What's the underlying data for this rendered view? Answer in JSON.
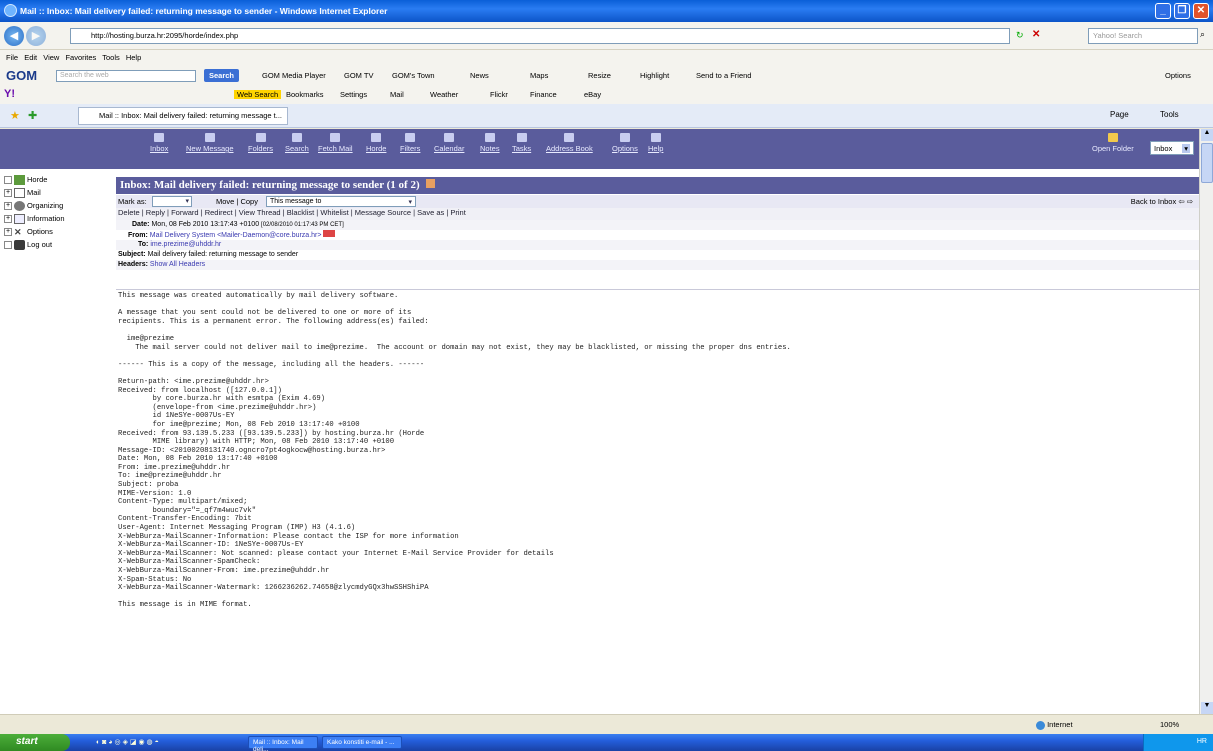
{
  "window": {
    "title": "Mail :: Inbox: Mail delivery failed: returning message to sender - Windows Internet Explorer",
    "url": "http://hosting.burza.hr:2095/horde/index.php",
    "search_placeholder": "Yahoo! Search"
  },
  "menubar": [
    "File",
    "Edit",
    "View",
    "Favorites",
    "Tools",
    "Help"
  ],
  "toolbar1": {
    "gom_search_placeholder": "Search the web",
    "search_button": "Search",
    "items": [
      "GOM Media Player",
      "GOM TV",
      "GOM's Town",
      "News",
      "Maps",
      "Resize",
      "Highlight",
      "Send to a Friend"
    ],
    "options": "Options"
  },
  "toolbar2": {
    "items": [
      "Web Search",
      "Bookmarks",
      "Settings",
      "Mail",
      "Weather",
      "Flickr",
      "Finance",
      "eBay"
    ]
  },
  "tab": {
    "label": "Mail :: Inbox: Mail delivery failed: returning message t..."
  },
  "command_bar": [
    "Page",
    "Tools"
  ],
  "horde_menu": {
    "items": [
      "Inbox",
      "New Message",
      "Folders",
      "Search",
      "Fetch Mail",
      "Horde",
      "Filters",
      "Calendar",
      "Notes",
      "Tasks",
      "Address Book",
      "Options",
      "Help"
    ],
    "open_folder": "Open Folder",
    "folder_select": "Inbox"
  },
  "sidebar": {
    "items": [
      "Horde",
      "Mail",
      "Organizing",
      "Information",
      "Options",
      "Log out"
    ]
  },
  "message": {
    "subject_title": "Inbox: Mail delivery failed: returning message to sender (1 of 2)",
    "mark_as": "Mark as:",
    "move_copy": "Move | Copy",
    "target_select": "This message to",
    "back_link": "Back to Inbox",
    "actions": "Delete | Reply | Forward | Redirect | View Thread | Blacklist | Whitelist | Message Source | Save as | Print",
    "date_label": "Date:",
    "date_value": "Mon, 08 Feb 2010 13:17:43 +0100",
    "date_local": "[02/08/2010 01:17:43 PM CET]",
    "from_label": "From:",
    "from_value": "Mail Delivery System <Mailer-Daemon@core.burza.hr>",
    "to_label": "To:",
    "to_value": "ime.prezime@uhddr.hr",
    "subject_label": "Subject:",
    "subject_value": "Mail delivery failed: returning message to sender",
    "headers_label": "Headers:",
    "headers_link": "Show All Headers"
  },
  "body_lines": [
    "This message was created automatically by mail delivery software.",
    "",
    "A message that you sent could not be delivered to one or more of its",
    "recipients. This is a permanent error. The following address(es) failed:",
    "",
    "  ime@prezime",
    "    The mail server could not deliver mail to ime@prezime.  The account or domain may not exist, they may be blacklisted, or missing the proper dns entries.",
    "",
    "------ This is a copy of the message, including all the headers. ------",
    "",
    "Return-path: <ime.prezime@uhddr.hr>",
    "Received: from localhost ([127.0.0.1])",
    "        by core.burza.hr with esmtpa (Exim 4.69)",
    "        (envelope-from <ime.prezime@uhddr.hr>)",
    "        id 1NeSYe-0007Us-EY",
    "        for ime@prezime; Mon, 08 Feb 2010 13:17:40 +0100",
    "Received: from 93.139.5.233 ([93.139.5.233]) by hosting.burza.hr (Horde",
    "        MIME library) with HTTP; Mon, 08 Feb 2010 13:17:40 +0100",
    "Message-ID: <20100208131740.ogncro7pt4ogkocw@hosting.burza.hr>",
    "Date: Mon, 08 Feb 2010 13:17:40 +0100",
    "From: ime.prezime@uhddr.hr",
    "To: ime@prezime@uhddr.hr",
    "Subject: proba",
    "MIME-Version: 1.0",
    "Content-Type: multipart/mixed;",
    "        boundary=\"=_qf7m4wuc7vk\"",
    "Content-Transfer-Encoding: 7bit",
    "User-Agent: Internet Messaging Program (IMP) H3 (4.1.6)",
    "X-WebBurza-MailScanner-Information: Please contact the ISP for more information",
    "X-WebBurza-MailScanner-ID: 1NeSYe-0007Us-EY",
    "X-WebBurza-MailScanner: Not scanned: please contact your Internet E-Mail Service Provider for details",
    "X-WebBurza-MailScanner-SpamCheck:",
    "X-WebBurza-MailScanner-From: ime.prezime@uhddr.hr",
    "X-Spam-Status: No",
    "X-WebBurza-MailScanner-Watermark: 1266236262.74658@zlycmdyGQx3hwSSHShiPA",
    "",
    "This message is in MIME format."
  ],
  "status": {
    "zone": "Internet",
    "zoom": "100%"
  },
  "taskbar": {
    "start": "start",
    "tasks": [
      "Mail :: Inbox: Mail deli...",
      "Kako konstiti e-mail - ..."
    ],
    "tray": "HR"
  }
}
